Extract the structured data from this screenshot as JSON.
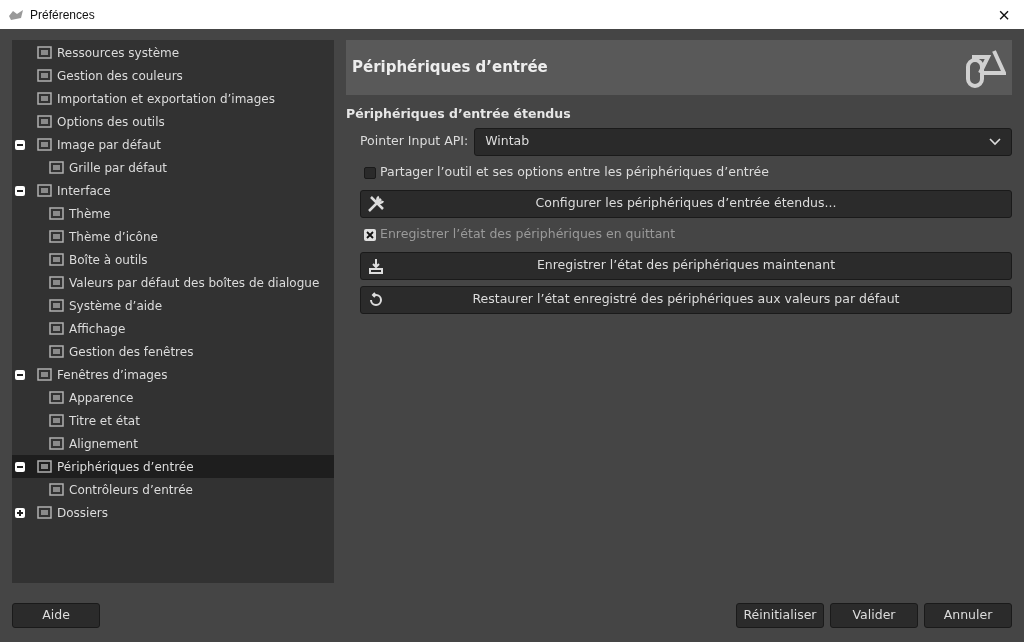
{
  "window": {
    "title": "Préférences",
    "close": "×"
  },
  "tree": [
    {
      "label": "Ressources système",
      "selected": false
    },
    {
      "label": "Gestion des couleurs",
      "selected": false
    },
    {
      "label": "Importation et exportation d’images",
      "selected": false
    },
    {
      "label": "Options des outils",
      "selected": false
    },
    {
      "label": "Image par défaut",
      "selected": false,
      "expanded": true,
      "children": [
        {
          "label": "Grille par défaut",
          "selected": false
        }
      ]
    },
    {
      "label": "Interface",
      "selected": false,
      "expanded": true,
      "children": [
        {
          "label": "Thème",
          "selected": false
        },
        {
          "label": "Thème d’icône",
          "selected": false
        },
        {
          "label": "Boîte à outils",
          "selected": false
        },
        {
          "label": "Valeurs par défaut des boîtes de dialogue",
          "selected": false
        },
        {
          "label": "Système d’aide",
          "selected": false
        },
        {
          "label": "Affichage",
          "selected": false
        },
        {
          "label": "Gestion des fenêtres",
          "selected": false
        }
      ]
    },
    {
      "label": "Fenêtres d’images",
      "selected": false,
      "expanded": true,
      "children": [
        {
          "label": "Apparence",
          "selected": false
        },
        {
          "label": "Titre et état",
          "selected": false
        },
        {
          "label": "Alignement",
          "selected": false
        }
      ]
    },
    {
      "label": "Périphériques d’entrée",
      "selected": true,
      "expanded": true,
      "children": [
        {
          "label": "Contrôleurs d’entrée",
          "selected": false
        }
      ]
    },
    {
      "label": "Dossiers",
      "selected": false,
      "expanded": false
    }
  ],
  "page": {
    "title": "Périphériques d’entrée",
    "section": "Périphériques d’entrée étendus",
    "controls": [
      {
        "kind": "select",
        "label": "Pointer Input API:",
        "value": "Wintab"
      },
      {
        "kind": "checkbox",
        "label": "Partager l’outil et ses options entre les périphériques d’entrée",
        "checked": false,
        "disabled": false
      },
      {
        "kind": "button",
        "label": "Configurer les périphériques d’entrée étendus..."
      },
      {
        "kind": "checkbox",
        "label": "Enregistrer l’état des périphériques en quittant",
        "checked": true,
        "disabled": true
      },
      {
        "kind": "button",
        "label": "Enregistrer l’état des périphériques maintenant"
      },
      {
        "kind": "button",
        "label": "Restaurer l’état enregistré des périphériques aux valeurs par défaut"
      }
    ]
  },
  "footer": {
    "left": [
      "Aide"
    ],
    "right": [
      "Réinitialiser",
      "Valider",
      "Annuler"
    ]
  }
}
